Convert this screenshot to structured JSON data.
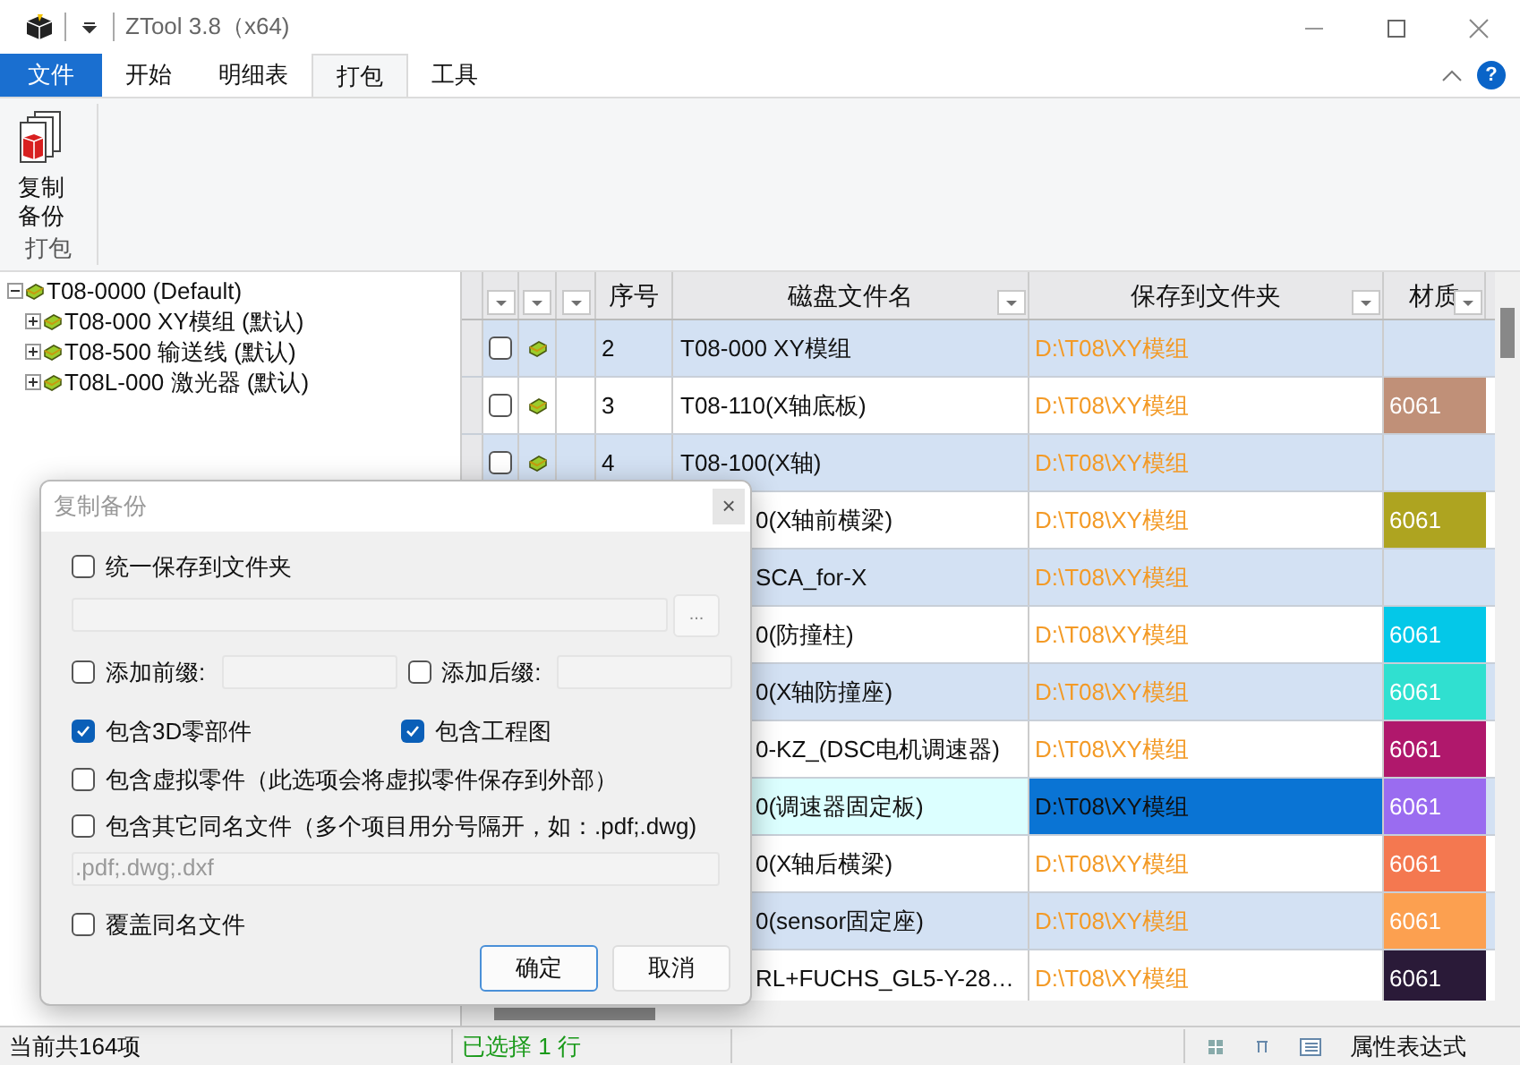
{
  "window": {
    "title": "ZTool 3.8（x64)"
  },
  "ribbon": {
    "tabs": [
      {
        "label": "文件",
        "kind": "file",
        "selected": false
      },
      {
        "label": "开始",
        "kind": "tab",
        "selected": false
      },
      {
        "label": "明细表",
        "kind": "tab",
        "selected": false
      },
      {
        "label": "打包",
        "kind": "tab",
        "selected": true
      },
      {
        "label": "工具",
        "kind": "tab",
        "selected": false
      }
    ],
    "help": "?",
    "button": {
      "label": "复制备份"
    },
    "group": "打包"
  },
  "tree": [
    {
      "label": "T08-0000 (Default)",
      "expanded": true,
      "children": [
        {
          "label": "T08-000 XY模组 (默认)",
          "expanded": false
        },
        {
          "label": "T08-500 输送线 (默认)",
          "expanded": false
        },
        {
          "label": "T08L-000 激光器 (默认)",
          "expanded": false
        }
      ]
    }
  ],
  "table": {
    "columns": [
      "序号",
      "磁盘文件名",
      "保存到文件夹",
      "材质"
    ],
    "rows": [
      {
        "seq": "2",
        "checked": false,
        "name": "T08-000 XY模组",
        "folder": "D:\\T08\\XY模组",
        "selected": false
      },
      {
        "seq": "3",
        "checked": false,
        "name": "T08-110(X轴底板)",
        "folder": "D:\\T08\\XY模组",
        "material": "6061",
        "color": "#c09078",
        "selected": false
      },
      {
        "seq": "4",
        "checked": false,
        "name": "T08-100(X轴)",
        "folder": "D:\\T08\\XY模组",
        "selected": false
      },
      {
        "name": "0(X轴前横梁)",
        "folder": "D:\\T08\\XY模组",
        "material": "6061",
        "color": "#aea420",
        "selected": false
      },
      {
        "name": "SCA_for-X",
        "folder": "D:\\T08\\XY模组",
        "selected": false
      },
      {
        "name": "0(防撞柱)",
        "folder": "D:\\T08\\XY模组",
        "material": "6061",
        "color": "#04c8e8",
        "selected": false
      },
      {
        "name": "0(X轴防撞座)",
        "folder": "D:\\T08\\XY模组",
        "material": "6061",
        "color": "#30e0d0",
        "selected": false
      },
      {
        "name": "0-KZ_(DSC电机调速器)",
        "folder": "D:\\T08\\XY模组",
        "material": "6061",
        "color": "#b0186c",
        "selected": false
      },
      {
        "name": "0(调速器固定板)",
        "folder": "D:\\T08\\XY模组",
        "material": "6061",
        "color": "#9a6cf0",
        "selected": true
      },
      {
        "name": "0(X轴后横梁)",
        "folder": "D:\\T08\\XY模组",
        "material": "6061",
        "color": "#f47850",
        "selected": false
      },
      {
        "name": "0(sensor固定座)",
        "folder": "D:\\T08\\XY模组",
        "material": "6061",
        "color": "#fca050",
        "selected": false
      },
      {
        "name": "RL+FUCHS_GL5-Y-28…",
        "folder": "D:\\T08\\XY模组",
        "material": "6061",
        "color": "#2a1a38",
        "selected": false
      }
    ]
  },
  "dialog": {
    "title": "复制备份",
    "close": "×",
    "unify": {
      "label": "统一保存到文件夹",
      "checked": false
    },
    "browse": "...",
    "prefix": {
      "label": "添加前缀:",
      "checked": false
    },
    "suffix": {
      "label": "添加后缀:",
      "checked": false
    },
    "options": [
      {
        "label": "包含3D零部件",
        "checked": true
      },
      {
        "label": "包含工程图",
        "checked": true
      }
    ],
    "virtual": {
      "label": "包含虚拟零件（此选项会将虚拟零件保存到外部）",
      "checked": false
    },
    "other": {
      "label": "包含其它同名文件（多个项目用分号隔开，如：.pdf;.dwg)",
      "checked": false
    },
    "extensions": {
      "value": ".pdf;.dwg;.dxf",
      "disabled": true
    },
    "overwrite": {
      "label": "覆盖同名文件",
      "checked": false
    },
    "buttons": [
      {
        "label": "确定",
        "default": true
      },
      {
        "label": "取消",
        "default": false
      }
    ]
  },
  "status_bar": {
    "count": "当前共164项",
    "selection": "已选择 1 行",
    "expression": "属性表达式"
  }
}
